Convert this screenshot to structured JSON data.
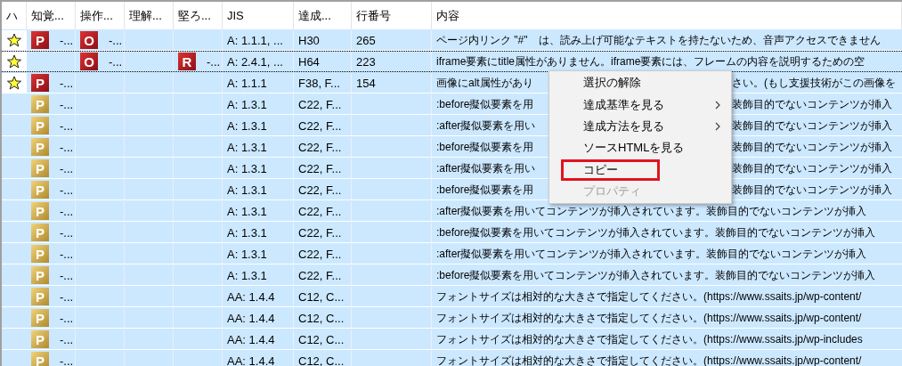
{
  "columns": [
    "ハ",
    "知覚...",
    "操作...",
    "理解...",
    "堅ろ...",
    "JIS",
    "達成...",
    "行番号",
    "内容"
  ],
  "rows": [
    {
      "selected": true,
      "focused": false,
      "star": true,
      "perceivable": {
        "letter": "P",
        "kind": "error",
        "text": "-..."
      },
      "operable": {
        "letter": "O",
        "kind": "error",
        "text": "-..."
      },
      "robust": null,
      "jis": "A: 1.1.1, ...",
      "technique": "H30",
      "line": "265",
      "content": "ページ内リンク \"#\"　は、読み上げ可能なテキストを持たないため、音声アクセスできません"
    },
    {
      "selected": true,
      "focused": true,
      "star": true,
      "perceivable": null,
      "operable": {
        "letter": "O",
        "kind": "error",
        "text": "-..."
      },
      "robust": {
        "letter": "R",
        "kind": "error",
        "text": "-..."
      },
      "jis": "A: 2.4.1, ...",
      "technique": "H64",
      "line": "223",
      "content": "iframe要素にtitle属性がありません。iframe要素には、フレームの内容を説明するための空"
    },
    {
      "selected": true,
      "focused": false,
      "star": true,
      "perceivable": {
        "letter": "P",
        "kind": "error",
        "text": "-..."
      },
      "operable": null,
      "robust": null,
      "jis": "A: 1.1.1",
      "technique": "F38, F...",
      "line": "154",
      "content": "画像にalt属性があり",
      "content_after_menu": "さい。(もし支援技術がこの画像を"
    },
    {
      "selected": true,
      "focused": false,
      "star": false,
      "perceivable": {
        "letter": "P",
        "kind": "warning",
        "text": "-..."
      },
      "operable": null,
      "robust": null,
      "jis": "A: 1.3.1",
      "technique": "C22, F...",
      "content": ":before擬似要素を用",
      "content_after_menu": "装飾目的でないコンテンツが挿入"
    },
    {
      "selected": true,
      "focused": false,
      "star": false,
      "perceivable": {
        "letter": "P",
        "kind": "warning",
        "text": "-..."
      },
      "operable": null,
      "robust": null,
      "jis": "A: 1.3.1",
      "technique": "C22, F...",
      "content": ":after擬似要素を用い",
      "content_after_menu": "装飾目的でないコンテンツが挿入"
    },
    {
      "selected": true,
      "focused": false,
      "star": false,
      "perceivable": {
        "letter": "P",
        "kind": "warning",
        "text": "-..."
      },
      "operable": null,
      "robust": null,
      "jis": "A: 1.3.1",
      "technique": "C22, F...",
      "content": ":before擬似要素を用",
      "content_after_menu": "装飾目的でないコンテンツが挿入"
    },
    {
      "selected": true,
      "focused": false,
      "star": false,
      "perceivable": {
        "letter": "P",
        "kind": "warning",
        "text": "-..."
      },
      "operable": null,
      "robust": null,
      "jis": "A: 1.3.1",
      "technique": "C22, F...",
      "content": ":after擬似要素を用い",
      "content_after_menu": "装飾目的でないコンテンツが挿入"
    },
    {
      "selected": true,
      "focused": false,
      "star": false,
      "perceivable": {
        "letter": "P",
        "kind": "warning",
        "text": "-..."
      },
      "operable": null,
      "robust": null,
      "jis": "A: 1.3.1",
      "technique": "C22, F...",
      "content": ":before擬似要素を用",
      "content_after_menu": "装飾目的でないコンテンツが挿入"
    },
    {
      "selected": true,
      "focused": false,
      "star": false,
      "perceivable": {
        "letter": "P",
        "kind": "warning",
        "text": "-..."
      },
      "operable": null,
      "robust": null,
      "jis": "A: 1.3.1",
      "technique": "C22, F...",
      "content": ":after擬似要素を用いてコンテンツが挿入されています。装飾目的でないコンテンツが挿入"
    },
    {
      "selected": true,
      "focused": false,
      "star": false,
      "perceivable": {
        "letter": "P",
        "kind": "warning",
        "text": "-..."
      },
      "operable": null,
      "robust": null,
      "jis": "A: 1.3.1",
      "technique": "C22, F...",
      "content": ":before擬似要素を用いてコンテンツが挿入されています。装飾目的でないコンテンツが挿入"
    },
    {
      "selected": true,
      "focused": false,
      "star": false,
      "perceivable": {
        "letter": "P",
        "kind": "warning",
        "text": "-..."
      },
      "operable": null,
      "robust": null,
      "jis": "A: 1.3.1",
      "technique": "C22, F...",
      "content": ":after擬似要素を用いてコンテンツが挿入されています。装飾目的でないコンテンツが挿入"
    },
    {
      "selected": true,
      "focused": false,
      "star": false,
      "perceivable": {
        "letter": "P",
        "kind": "warning",
        "text": "-..."
      },
      "operable": null,
      "robust": null,
      "jis": "A: 1.3.1",
      "technique": "C22, F...",
      "content": ":before擬似要素を用いてコンテンツが挿入されています。装飾目的でないコンテンツが挿入"
    },
    {
      "selected": true,
      "focused": false,
      "star": false,
      "perceivable": {
        "letter": "P",
        "kind": "warning",
        "text": "-..."
      },
      "operable": null,
      "robust": null,
      "jis": "AA: 1.4.4",
      "technique": "C12, C...",
      "content": "フォントサイズは相対的な大きさで指定してください。(https://www.ssaits.jp/wp-content/"
    },
    {
      "selected": true,
      "focused": false,
      "star": false,
      "perceivable": {
        "letter": "P",
        "kind": "warning",
        "text": "-..."
      },
      "operable": null,
      "robust": null,
      "jis": "AA: 1.4.4",
      "technique": "C12, C...",
      "content": "フォントサイズは相対的な大きさで指定してください。(https://www.ssaits.jp/wp-content/"
    },
    {
      "selected": true,
      "focused": false,
      "star": false,
      "perceivable": {
        "letter": "P",
        "kind": "warning",
        "text": "-..."
      },
      "operable": null,
      "robust": null,
      "jis": "AA: 1.4.4",
      "technique": "C12, C...",
      "content": "フォントサイズは相対的な大きさで指定してください。(https://www.ssaits.jp/wp-includes"
    },
    {
      "selected": true,
      "focused": false,
      "star": false,
      "perceivable": {
        "letter": "P",
        "kind": "warning",
        "text": "-..."
      },
      "operable": null,
      "robust": null,
      "jis": "AA: 1.4.4",
      "technique": "C12, C...",
      "content": "フォントサイズは相対的な大きさで指定してください。(https://www.ssaits.jp/wp-content/"
    }
  ],
  "context_menu": [
    {
      "label": "選択の解除",
      "submenu": false,
      "disabled": false,
      "annotated": false
    },
    {
      "label": "達成基準を見る",
      "submenu": true,
      "disabled": false,
      "annotated": false
    },
    {
      "label": "達成方法を見る",
      "submenu": true,
      "disabled": false,
      "annotated": false
    },
    {
      "label": "ソースHTMLを見る",
      "submenu": false,
      "disabled": false,
      "annotated": false
    },
    {
      "label": "コピー",
      "submenu": false,
      "disabled": false,
      "annotated": true
    },
    {
      "label": "プロパティ",
      "submenu": false,
      "disabled": true,
      "annotated": false
    }
  ]
}
